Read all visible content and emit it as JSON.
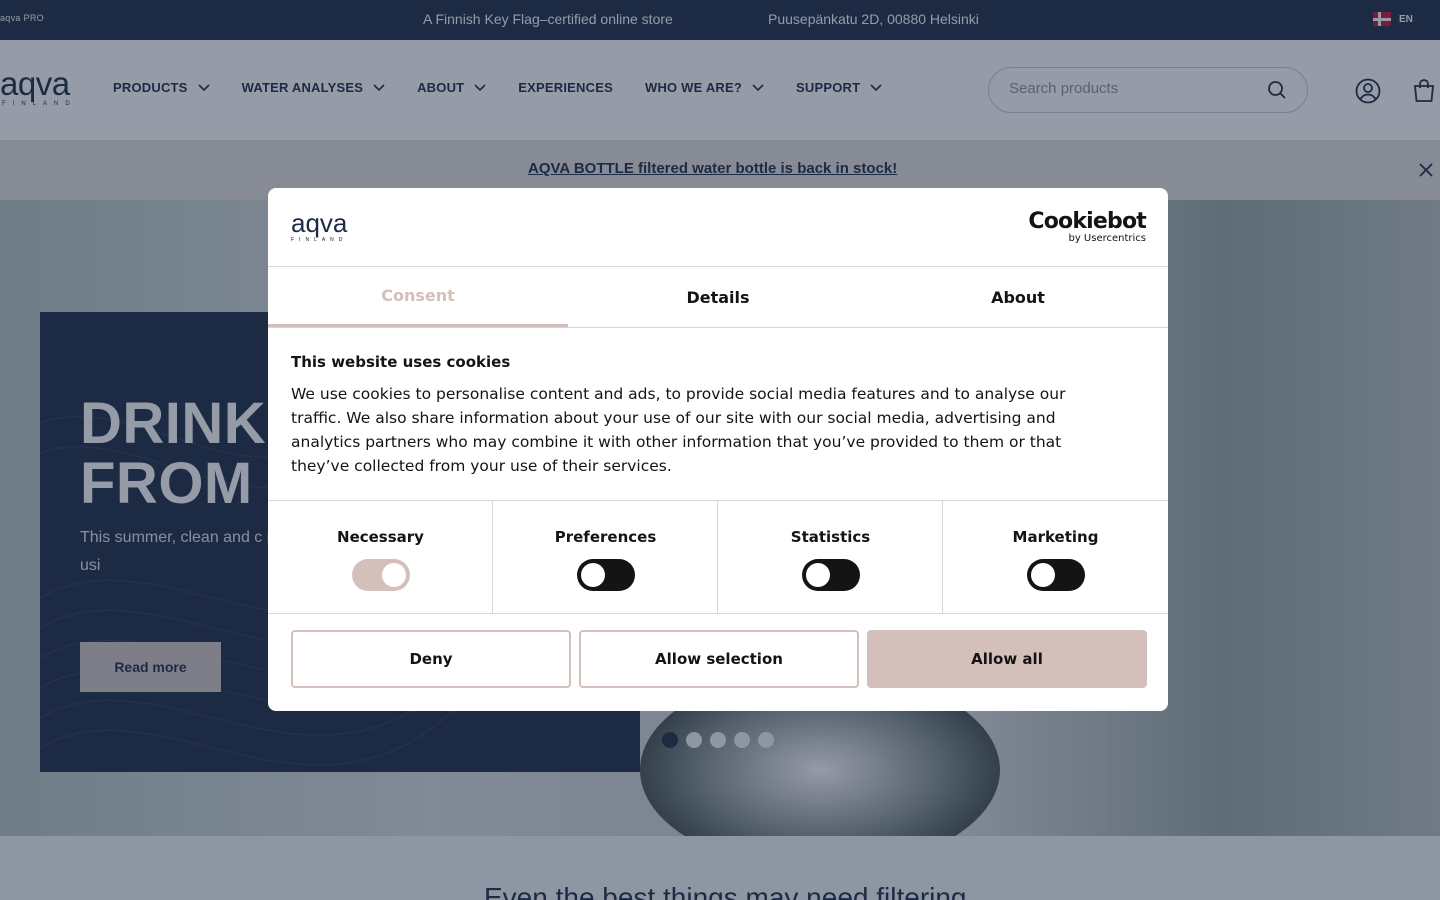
{
  "topbar": {
    "pro_label": "aqva PRO",
    "tagline": "A Finnish Key Flag–certified online store",
    "address": "Puusepänkatu 2D, 00880 Helsinki",
    "language": "EN"
  },
  "header": {
    "logo_word": "aqva",
    "logo_sub": "FINLAND",
    "nav": [
      {
        "label": "PRODUCTS"
      },
      {
        "label": "WATER ANALYSES"
      },
      {
        "label": "ABOUT"
      },
      {
        "label": "EXPERIENCES"
      },
      {
        "label": "WHO WE ARE?"
      },
      {
        "label": "SUPPORT"
      }
    ],
    "search_placeholder": "Search products"
  },
  "announcement": {
    "text": "AQVA BOTTLE filtered water bottle is back in stock!"
  },
  "hero": {
    "title": "DRINKI\nFROM T",
    "text": "This summer, clean and c river or pond? Fresh natu make them drinkable usi",
    "button": "Read more",
    "slides_total": 5,
    "slide_active": 1
  },
  "section_title": "Even the best things may need filtering",
  "cookie_dialog": {
    "logo_word": "aqva",
    "logo_sub": "FINLAND",
    "brand": "Cookiebot",
    "brand_sub": "by Usercentrics",
    "tabs": [
      {
        "label": "Consent"
      },
      {
        "label": "Details"
      },
      {
        "label": "About"
      }
    ],
    "title": "This website uses cookies",
    "body": "We use cookies to personalise content and ads, to provide social media features and to analyse our traffic. We also share information about your use of our site with our social media, advertising and analytics partners who may combine it with other information that you’ve provided to them or that they’ve collected from your use of their services.",
    "categories": [
      {
        "label": "Necessary",
        "checked": true
      },
      {
        "label": "Preferences",
        "checked": false
      },
      {
        "label": "Statistics",
        "checked": false
      },
      {
        "label": "Marketing",
        "checked": false
      }
    ],
    "buttons": {
      "deny": "Deny",
      "allow_selection": "Allow selection",
      "allow_all": "Allow all"
    }
  }
}
